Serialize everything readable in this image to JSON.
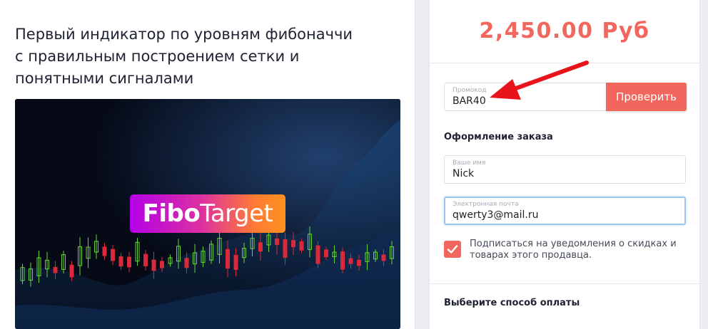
{
  "product": {
    "title_lines": [
      "Первый индикатор по уровням фибоначчи",
      "с правильным построением сетки и",
      "понятными сигналами"
    ],
    "logo_bold": "Fibo",
    "logo_regular": "Target"
  },
  "order": {
    "price": "2,450.00 Руб",
    "promo": {
      "label": "Промокод",
      "value": "BAR40"
    },
    "check_button": "Проверить",
    "order_section_title": "Оформление заказа",
    "name": {
      "label": "Ваше имя",
      "value": "Nick"
    },
    "email": {
      "label": "Электронная почта",
      "value": "qwerty3@mail.ru"
    },
    "subscribe": {
      "checked": true,
      "text": "Подписаться на уведомления о скидках и товарах этого продавца."
    },
    "payment_section_title": "Выберите способ оплаты"
  },
  "colors": {
    "accent": "#f2675d",
    "annotation_arrow": "#e8131b",
    "candle_up": "#67d43b",
    "candle_down": "#d9293b"
  },
  "icons": {
    "checkbox": "checkmark-icon",
    "annotation": "arrow-icon"
  }
}
